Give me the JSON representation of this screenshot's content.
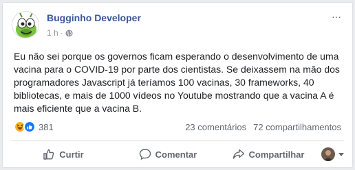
{
  "post": {
    "author": "Bugginho Developer",
    "time": "1 h",
    "separator": "·",
    "privacy_icon": "globe-icon",
    "more_icon": "···",
    "text": "Eu não sei porque os governos ficam esperando o desenvolvimento de uma vacina para o COVID-19 por parte dos cientistas. Se deixassem na mão dos programadores Javascript já teríamos 100 vacinas, 30 frameworks, 40 bibliotecas, e mais de 1000 vídeos no Youtube mostrando que a vacina A é mais eficiente que a vacina B."
  },
  "reactions": {
    "icons": [
      "haha-icon",
      "like-icon"
    ],
    "count": "381",
    "comments": "23 comentários",
    "shares": "72 compartilhamentos"
  },
  "actions": {
    "like_label": "Curtir",
    "comment_label": "Comentar",
    "share_label": "Compartilhar"
  },
  "colors": {
    "author_link": "#385898",
    "secondary_text": "#90949c",
    "action_text": "#606770",
    "like_blue": "#1877f2",
    "haha_yellow": "#f7b125",
    "avatar_green": "#7cc242"
  }
}
